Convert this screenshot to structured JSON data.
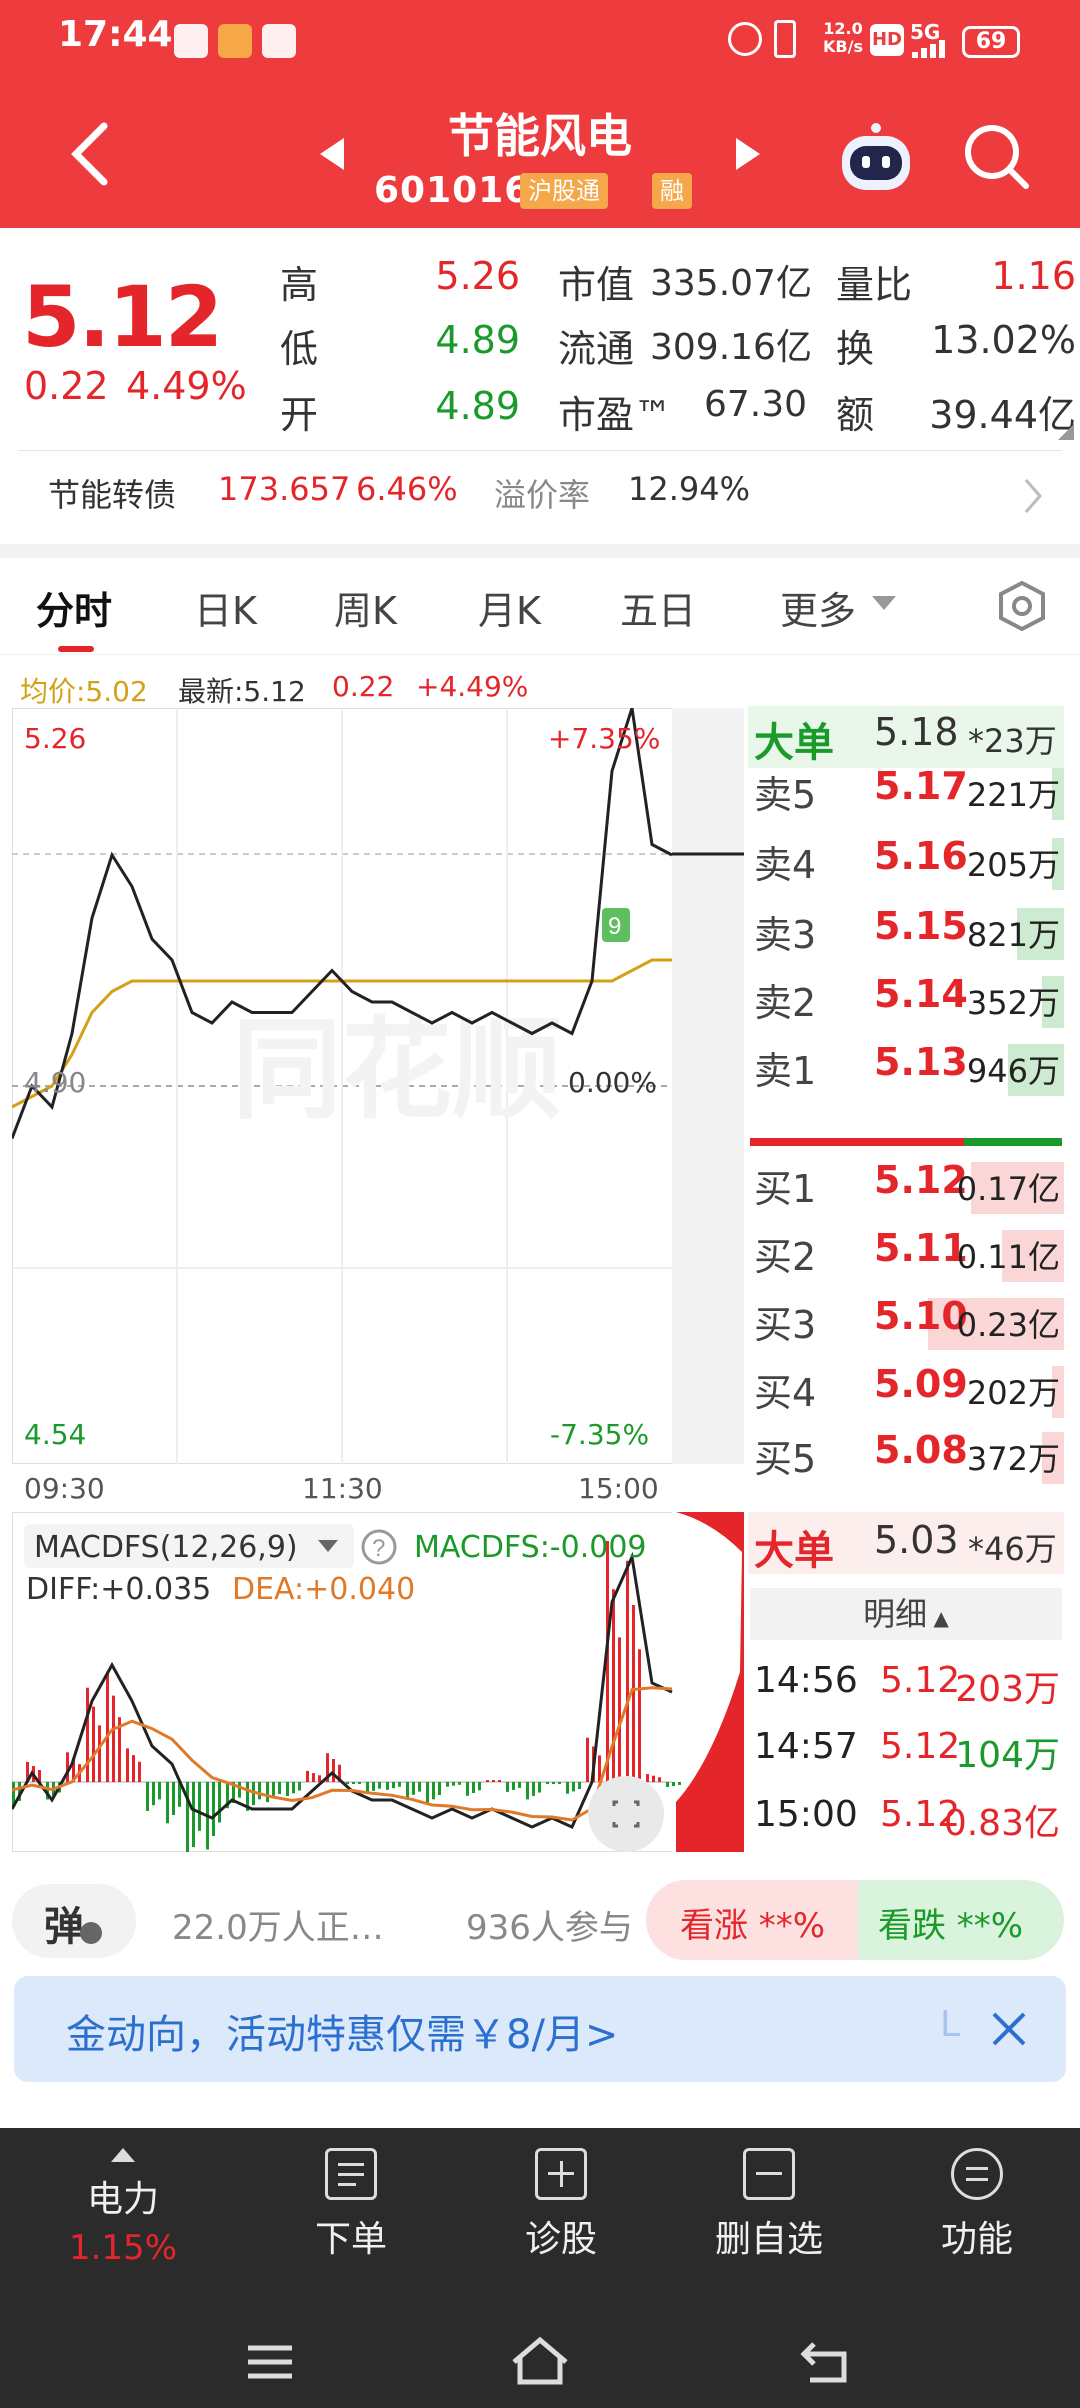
{
  "status_bar": {
    "time": "17:44",
    "net_speed": "12.0\nKB/s",
    "net_speed_top": "12.0",
    "net_speed_bottom": "KB/s",
    "hd": "HD",
    "signal": "5G",
    "battery": "69"
  },
  "header": {
    "title": "节能风电",
    "code": "601016",
    "tag_hk": "沪股通",
    "tag_margin": "融"
  },
  "quote": {
    "price": "5.12",
    "change": "0.22",
    "change_pct": "4.49%",
    "high_label": "高",
    "high": "5.26",
    "low_label": "低",
    "low": "4.89",
    "open_label": "开",
    "open": "4.89",
    "mcap_label": "市值",
    "mcap": "335.07亿",
    "float_label": "流通",
    "float": "309.16亿",
    "pe_label": "市盈™",
    "pe": "67.30",
    "vol_ratio_label": "量比",
    "vol_ratio": "1.16",
    "turnover_label": "换",
    "turnover": "13.02%",
    "amount_label": "额",
    "amount": "39.44亿"
  },
  "bond": {
    "name": "节能转债",
    "price": "173.657",
    "pct": "6.46%",
    "premium_label": "溢价率",
    "premium": "12.94%"
  },
  "tabs": [
    "分时",
    "日K",
    "周K",
    "月K",
    "五日",
    "更多"
  ],
  "chart": {
    "avg_label": "均价:5.02",
    "latest_label": "最新:5.12",
    "chg": "0.22",
    "chg_pct": "+4.49%",
    "y_top": "5.26",
    "y_top_pct": "+7.35%",
    "y_mid": "4.90",
    "y_mid_pct": "0.00%",
    "y_bot": "4.54",
    "y_bot_pct": "-7.35%",
    "x_labels": [
      "09:30",
      "11:30",
      "15:00"
    ],
    "marker": "9"
  },
  "chart_data": {
    "type": "line",
    "series": [
      {
        "values": [
          4.85,
          4.9,
          4.88,
          4.95,
          5.06,
          5.12,
          5.09,
          5.04,
          5.02,
          4.97,
          4.96,
          4.98,
          4.97,
          4.97,
          4.97,
          4.99,
          5.01,
          4.99,
          4.98,
          4.98,
          4.97,
          4.96,
          4.97,
          4.96,
          4.97,
          4.96,
          4.95,
          4.96,
          4.95,
          5.0,
          5.2,
          5.26,
          5.13,
          5.12
        ]
      },
      {
        "values": [
          4.88,
          4.89,
          4.9,
          4.93,
          4.97,
          4.99,
          5.0,
          5.0,
          5.0,
          5.0,
          5.0,
          5.0,
          5.0,
          5.0,
          5.0,
          5.0,
          5.0,
          5.0,
          5.0,
          5.0,
          5.0,
          5.0,
          5.0,
          5.0,
          5.0,
          5.0,
          5.0,
          5.0,
          5.0,
          5.0,
          5.0,
          5.01,
          5.02,
          5.02
        ]
      }
    ],
    "ylim": [
      4.54,
      5.26
    ]
  },
  "orderbook": {
    "big_sell": {
      "label": "大单",
      "price": "5.18",
      "vol": "*23万"
    },
    "asks": [
      {
        "label": "卖5",
        "price": "5.17",
        "vol": "221万",
        "fill": 0.04
      },
      {
        "label": "卖4",
        "price": "5.16",
        "vol": "205万",
        "fill": 0.04
      },
      {
        "label": "卖3",
        "price": "5.15",
        "vol": "821万",
        "fill": 0.15
      },
      {
        "label": "卖2",
        "price": "5.14",
        "vol": "352万",
        "fill": 0.07
      },
      {
        "label": "卖1",
        "price": "5.13",
        "vol": "946万",
        "fill": 0.18
      }
    ],
    "bids": [
      {
        "label": "买1",
        "price": "5.12",
        "vol": "0.17亿",
        "fill": 0.3
      },
      {
        "label": "买2",
        "price": "5.11",
        "vol": "0.11亿",
        "fill": 0.2
      },
      {
        "label": "买3",
        "price": "5.10",
        "vol": "0.23亿",
        "fill": 0.44
      },
      {
        "label": "买4",
        "price": "5.09",
        "vol": "202万",
        "fill": 0.04
      },
      {
        "label": "买5",
        "price": "5.08",
        "vol": "372万",
        "fill": 0.07
      }
    ],
    "big_buy": {
      "label": "大单",
      "price": "5.03",
      "vol": "*46万"
    },
    "detail_label": "明细",
    "ticks": [
      {
        "time": "14:56",
        "price": "5.12",
        "vol": "203万"
      },
      {
        "time": "14:57",
        "price": "5.12",
        "vol": "104万"
      },
      {
        "time": "15:00",
        "price": "5.12",
        "vol": "0.83亿"
      }
    ]
  },
  "macd": {
    "name": "MACDFS(12,26,9)",
    "value": "MACDFS:-0.009",
    "diff": "DIFF:+0.035",
    "dea": "DEA:+0.040"
  },
  "social": {
    "bullet": "弹",
    "reading": "22.0万人正…",
    "joined": "936人参与",
    "bull": "看涨 **%",
    "bear": "看跌 **%"
  },
  "banner": {
    "text": "金动向，活动特惠仅需￥8/月>",
    "tail": "L"
  },
  "toolbar": {
    "sector": "电力",
    "sector_pct": "1.15%",
    "order": "下单",
    "diagnose": "诊股",
    "delete_fav": "删自选",
    "function": "功能"
  },
  "colors": {
    "header": "#ee3b3e",
    "up": "#e4262b",
    "down": "#1a9a2a",
    "avg_line": "#d4a017"
  }
}
